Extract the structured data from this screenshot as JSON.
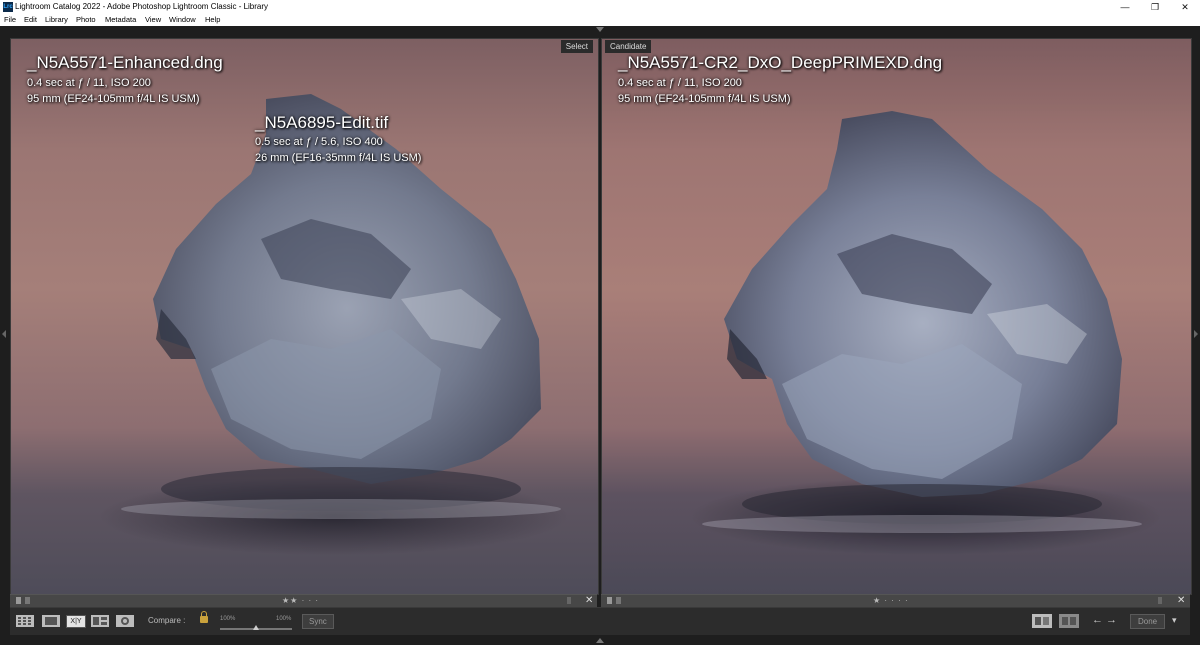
{
  "window": {
    "title": "Lightroom Catalog 2022 - Adobe Photoshop Lightroom Classic - Library",
    "app_icon": "Lrc",
    "minimize_glyph": "—",
    "maximize_glyph": "❐",
    "close_glyph": "✕"
  },
  "menu": [
    "File",
    "Edit",
    "Library",
    "Photo",
    "Metadata",
    "View",
    "Window",
    "Help"
  ],
  "left_pane": {
    "badge": "Select",
    "filename": "_N5A5571-Enhanced.dng",
    "exposure": "0.4 sec at ƒ / 11, ISO 200",
    "lens": "95 mm (EF24-105mm f/4L IS USM)",
    "overlay_filename": "_N5A6895-Edit.tif",
    "overlay_exposure": "0.5 sec at ƒ / 5.6, ISO 400",
    "overlay_lens": "26 mm (EF16-35mm f/4L IS USM)",
    "stars": "★★ · · ·",
    "close_glyph": "✕"
  },
  "right_pane": {
    "badge": "Candidate",
    "filename": "_N5A5571-CR2_DxO_DeepPRIMEXD.dng",
    "exposure": "0.4 sec at ƒ / 11, ISO 200",
    "lens": "95 mm (EF24-105mm f/4L IS USM)",
    "stars": "★ · · · ·",
    "close_glyph": "✕"
  },
  "toolbar": {
    "compare_label": "Compare :",
    "zoom_left": "100%",
    "zoom_right": "100%",
    "zoom_slider_value": 0.5,
    "sync_label": "Sync",
    "done_label": "Done",
    "xy_label": "X|Y",
    "prev_glyph": "←",
    "next_glyph": "→",
    "menu_glyph": "▾"
  },
  "colors": {
    "chrome_bg": "#1e1e1e",
    "panel_bg": "#2c2c2c",
    "badge_bg": "#2b2b2b",
    "lock": "#caa23c"
  }
}
